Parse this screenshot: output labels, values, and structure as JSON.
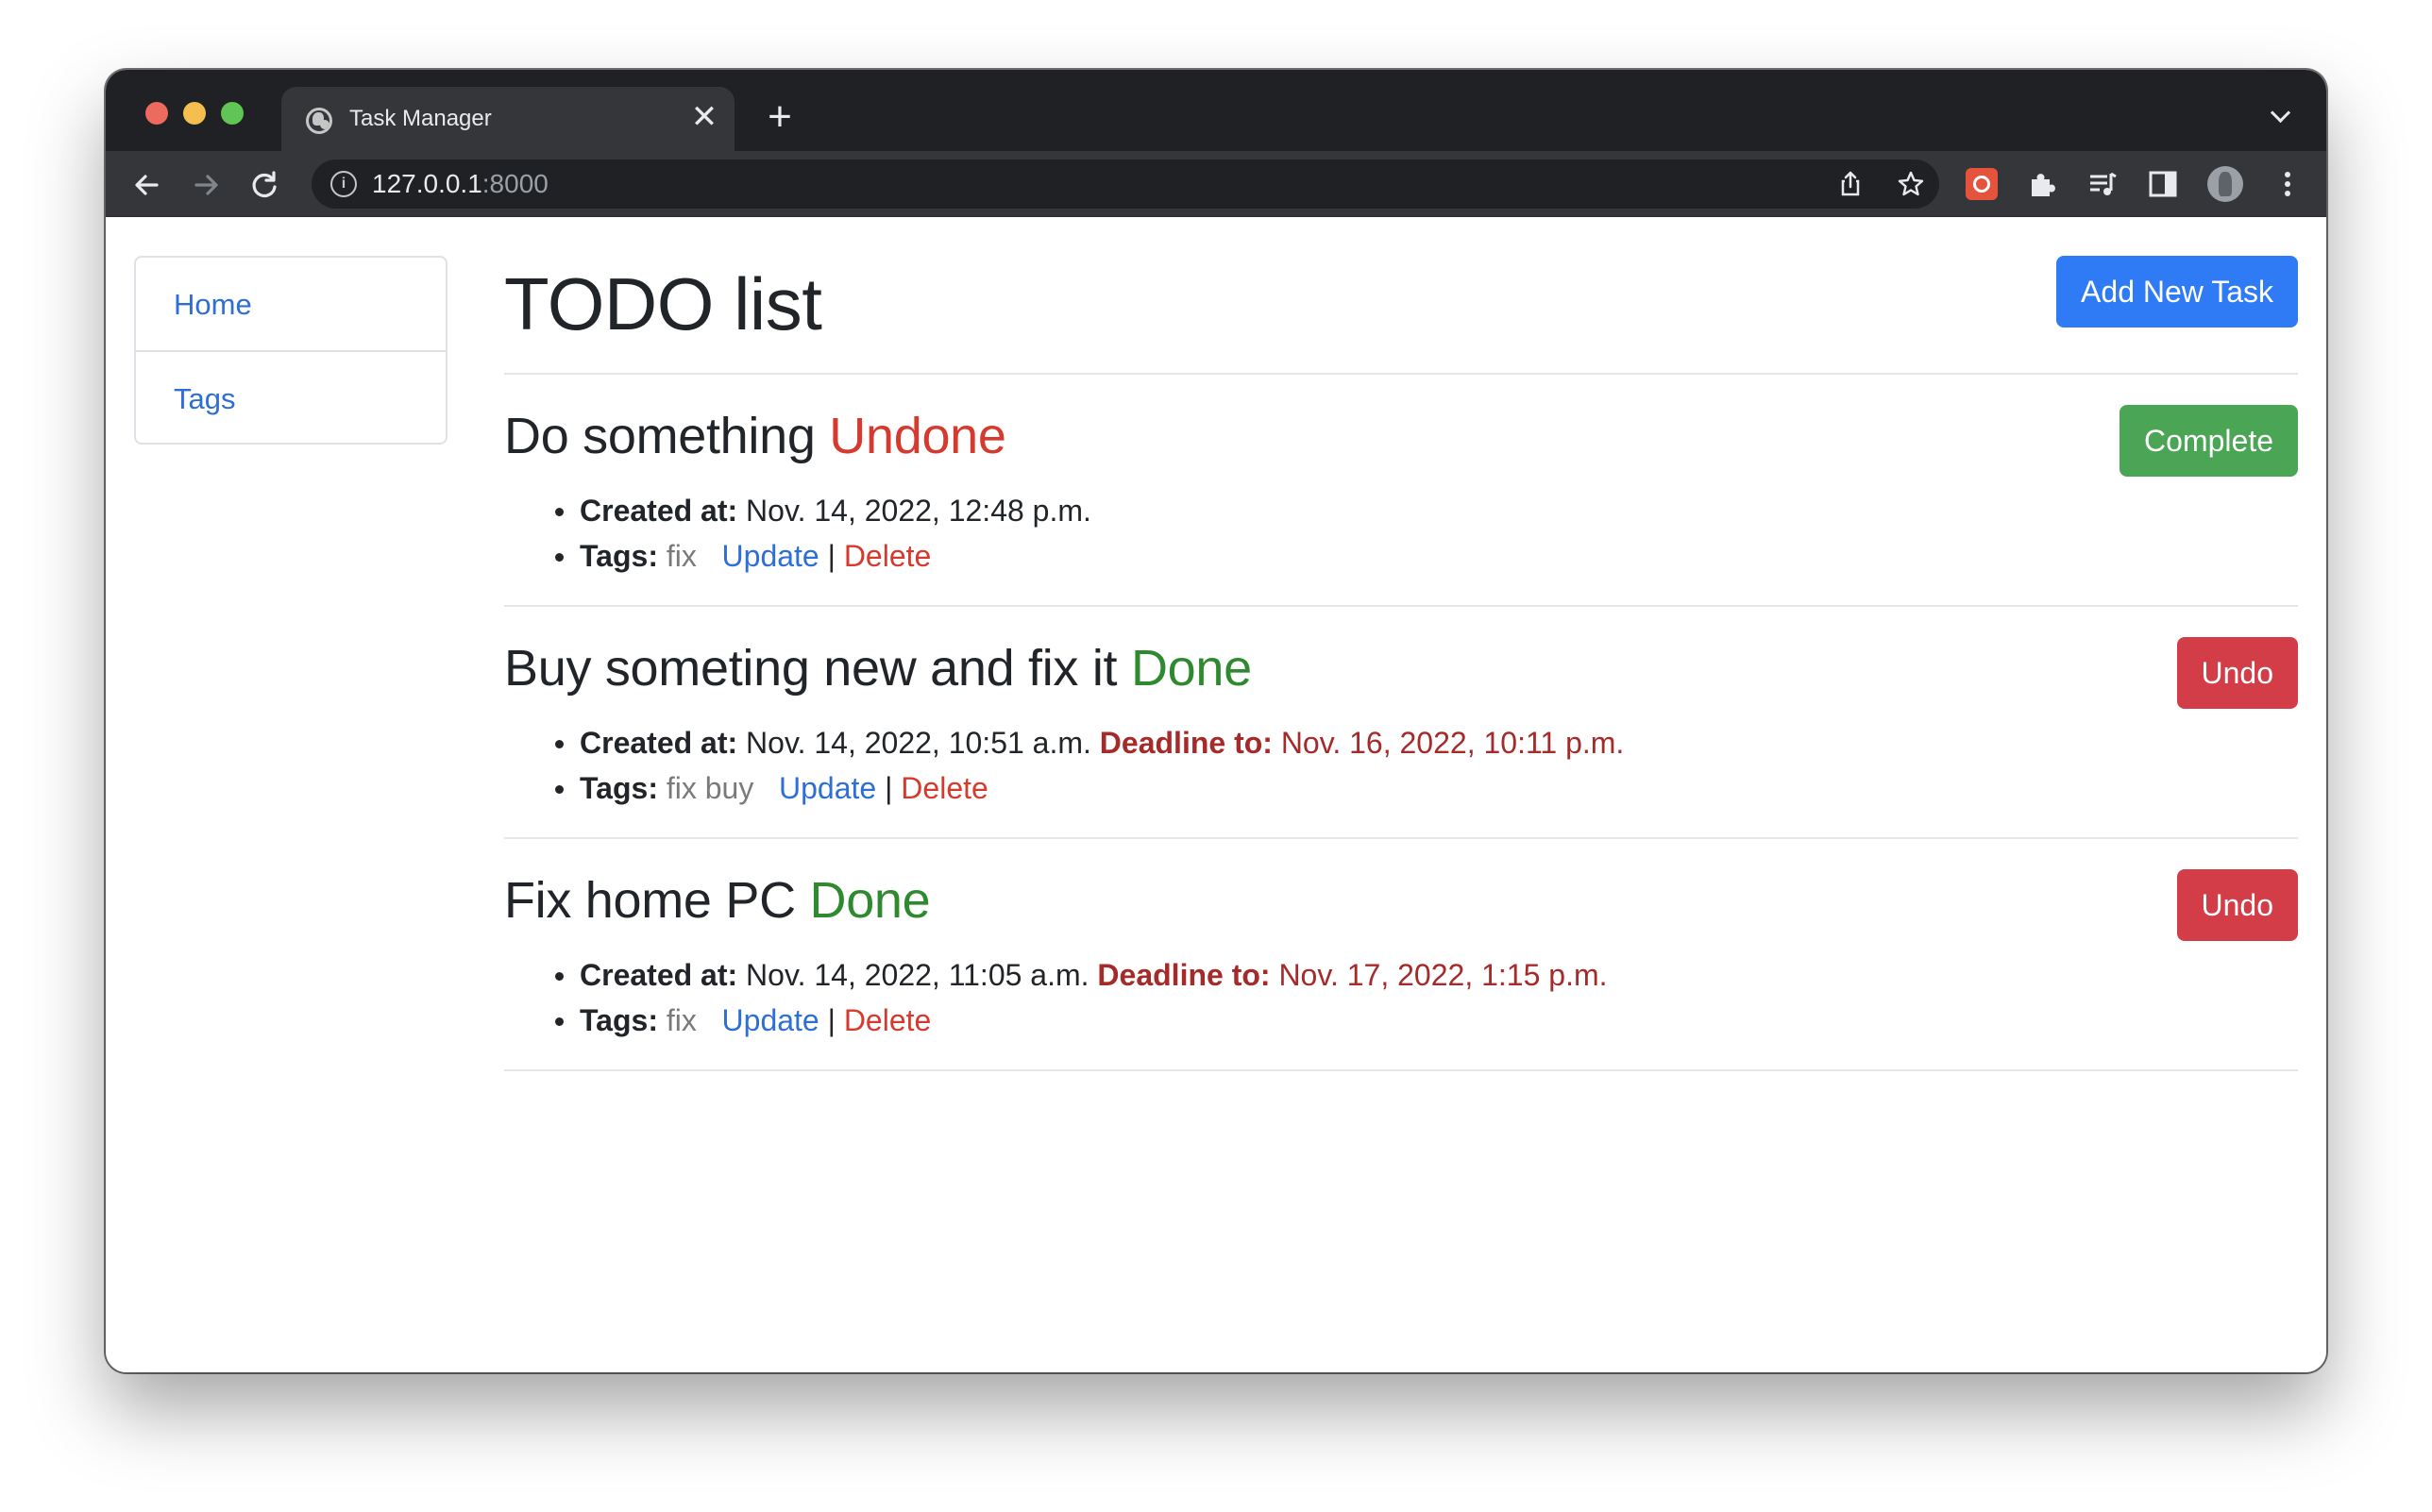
{
  "browser": {
    "tab_title": "Task Manager",
    "tab_close": "✕",
    "new_tab": "+",
    "url_host": "127.0.0.1",
    "url_port": ":8000",
    "info_glyph": "i"
  },
  "sidebar": {
    "items": [
      {
        "label": "Home"
      },
      {
        "label": "Tags"
      }
    ]
  },
  "header": {
    "title": "TODO list",
    "add_button": "Add New Task"
  },
  "labels": {
    "created_at": "Created at:",
    "deadline_to": "Deadline to:",
    "tags": "Tags:",
    "update": "Update",
    "delete": "Delete",
    "separator": "|"
  },
  "tasks": [
    {
      "title": "Do something",
      "status": "Undone",
      "action": "Complete",
      "created_at": "Nov. 14, 2022, 12:48 p.m.",
      "deadline": "",
      "tags": "fix"
    },
    {
      "title": "Buy someting new and fix it",
      "status": "Done",
      "action": "Undo",
      "created_at": "Nov. 14, 2022, 10:51 a.m.",
      "deadline": "Nov. 16, 2022, 10:11 p.m.",
      "tags": "fix buy"
    },
    {
      "title": "Fix home PC",
      "status": "Done",
      "action": "Undo",
      "created_at": "Nov. 14, 2022, 11:05 a.m.",
      "deadline": "Nov. 17, 2022, 1:15 p.m.",
      "tags": "fix"
    }
  ],
  "colors": {
    "primary": "#2f7bf5",
    "success": "#4aa554",
    "danger": "#d23d48",
    "undone": "#d63a2f",
    "done": "#2f8a2f",
    "deadline": "#a52a2a",
    "link": "#2e6fd6"
  }
}
